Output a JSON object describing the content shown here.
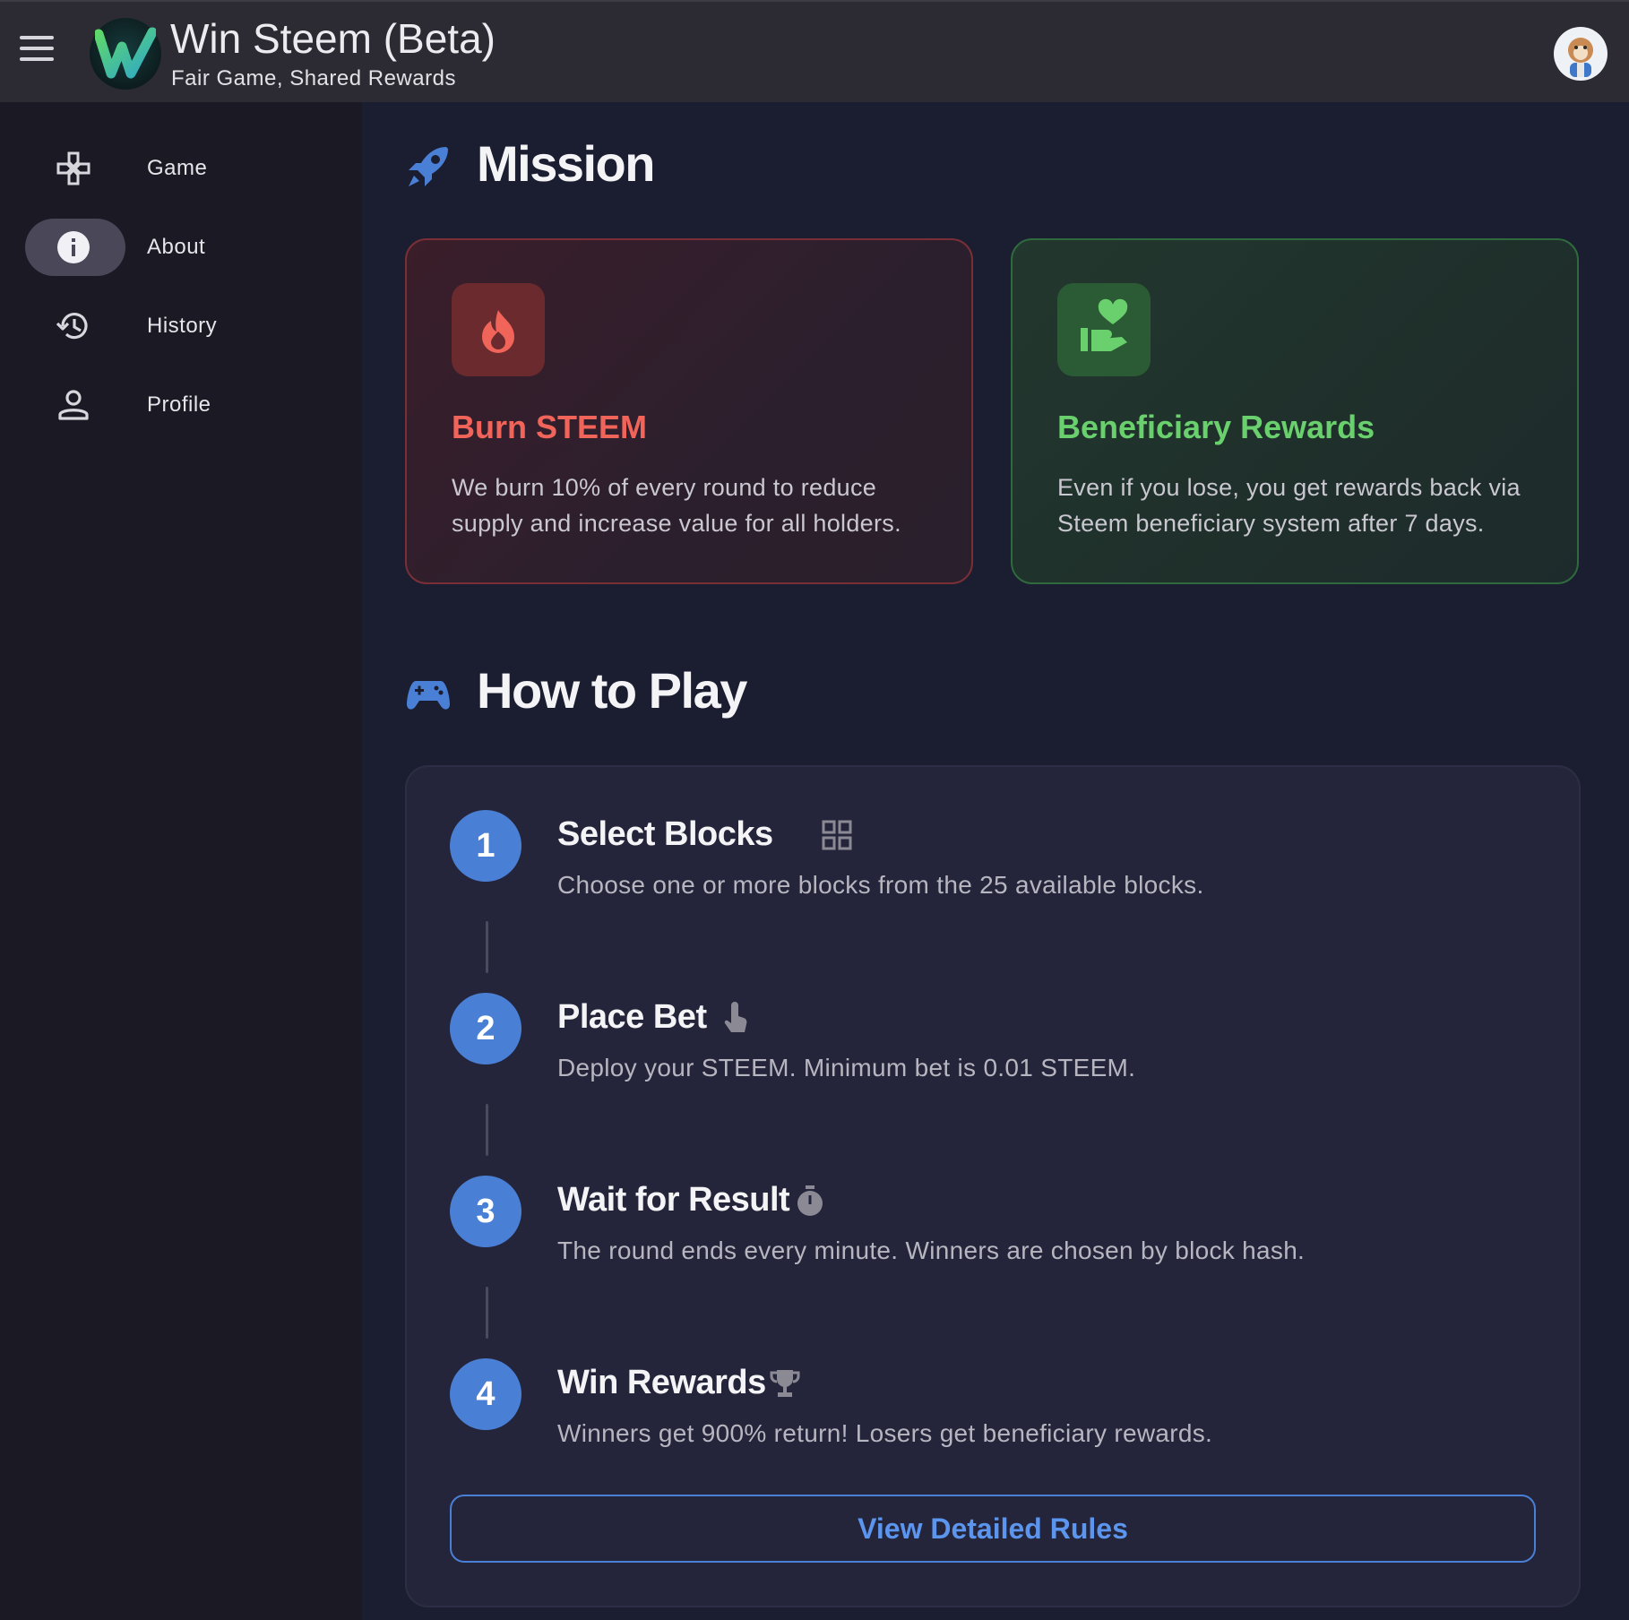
{
  "app": {
    "title": "Win Steem (Beta)",
    "subtitle": "Fair Game, Shared Rewards",
    "logo_letter": "W"
  },
  "sidebar": {
    "items": [
      {
        "label": "Game",
        "icon": "gamepad-icon",
        "active": false
      },
      {
        "label": "About",
        "icon": "info-icon",
        "active": true
      },
      {
        "label": "History",
        "icon": "history-icon",
        "active": false
      },
      {
        "label": "Profile",
        "icon": "person-icon",
        "active": false
      }
    ]
  },
  "mission": {
    "heading": "Mission",
    "icon": "rocket-icon",
    "cards": [
      {
        "title": "Burn STEEM",
        "description": "We burn 10% of every round to reduce supply and increase value for all holders.",
        "icon": "fire-icon",
        "accent": "#f0645a"
      },
      {
        "title": "Beneficiary Rewards",
        "description": "Even if you lose, you get rewards back via Steem beneficiary system after 7 days.",
        "icon": "hand-heart-icon",
        "accent": "#6ad06e"
      }
    ]
  },
  "how_to_play": {
    "heading": "How to Play",
    "icon": "controller-icon",
    "steps": [
      {
        "number": "1",
        "title": "Select Blocks",
        "description": "Choose one or more blocks from the 25 available blocks.",
        "icon": "grid-icon"
      },
      {
        "number": "2",
        "title": "Place Bet",
        "description": "Deploy your STEEM. Minimum bet is 0.01 STEEM.",
        "icon": "tap-icon"
      },
      {
        "number": "3",
        "title": "Wait for Result",
        "description": "The round ends every minute. Winners are chosen by block hash.",
        "icon": "stopwatch-icon"
      },
      {
        "number": "4",
        "title": "Win Rewards",
        "description": "Winners get 900% return! Losers get beneficiary rewards.",
        "icon": "trophy-icon"
      }
    ],
    "button_label": "View Detailed Rules"
  },
  "colors": {
    "accent_blue": "#4a7fd6",
    "burn_red": "#f0645a",
    "benef_green": "#6ad06e"
  }
}
